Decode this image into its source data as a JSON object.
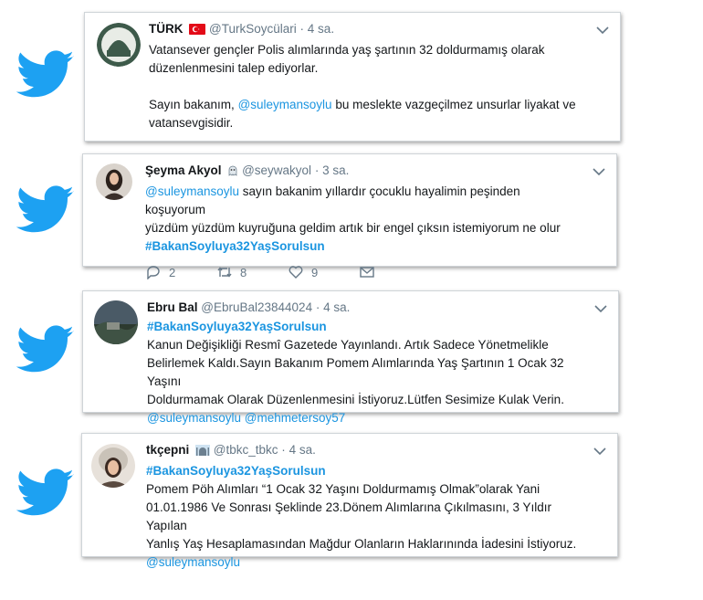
{
  "colors": {
    "twitter_blue": "#1da1f2",
    "link": "#1b95e0",
    "secondary": "#657786"
  },
  "tweets": [
    {
      "name": "TÜRK",
      "badge": "turkish-flag",
      "handle": "@TurkSoycülari",
      "sep": "·",
      "time": "4 sa.",
      "line1": "Vatansever gençler Polis alımlarında yaş şartının 32 doldurmamış olarak",
      "line2": "düzenlenmesini talep ediyorlar.",
      "line3_pre": "Sayın bakanım, ",
      "line3_mention": "@suleymansoylu",
      "line3_post": " bu meslekte vazgeçilmez unsurlar liyakat ve",
      "line4": "vatansevgisidir."
    },
    {
      "name": "Şeyma Akyol",
      "badge": "ghost-emoji",
      "handle": "@seywakyol",
      "sep": "·",
      "time": "3 sa.",
      "mention": "@suleymansoylu",
      "line1_post": " sayın bakanim yıllardır çocuklu hayalimin peşinden koşuyorum",
      "line2": "yüzdüm yüzdüm kuyruğuna geldim artık bir engel çıksın istemiyorum ne olur",
      "hashtag": "#BakanSoyluya32YaşSorulsun",
      "replies": "2",
      "retweets": "8",
      "likes": "9"
    },
    {
      "name": "Ebru Bal",
      "handle": "@EbruBal23844024",
      "sep": "·",
      "time": "4 sa.",
      "hashtag": "#BakanSoyluya32YaşSorulsun",
      "line1": "Kanun Değişikliği Resmî Gazetede Yayınlandı. Artık Sadece Yönetmelikle",
      "line2": "Belirlemek Kaldı.Sayın Bakanım  Pomem Alımlarında Yaş Şartının 1 Ocak 32 Yaşını",
      "line3": "Doldurmamak Olarak Düzenlenmesini İstiyoruz.Lütfen Sesimize Kulak Verin.",
      "mention1": "@suleymansoylu",
      "mention2": "@mehmetersoy57"
    },
    {
      "name": "tkçepni",
      "badge": "mosque-emoji",
      "handle": "@tbkc_tbkc",
      "sep": "·",
      "time": "4 sa.",
      "hashtag": "#BakanSoyluya32YaşSorulsun",
      "line1": "Pomem Pöh Alımları “1 Ocak 32 Yaşını Doldurmamış Olmak”olarak Yani",
      "line2": "01.01.1986 Ve Sonrası Şeklinde 23.Dönem Alımlarına Çıkılmasını, 3 Yıldır Yapılan",
      "line3": "Yanlış Yaş Hesaplamasından Mağdur Olanların Haklarınında İadesini İstiyoruz.",
      "mention": "@suleymansoylu"
    }
  ]
}
